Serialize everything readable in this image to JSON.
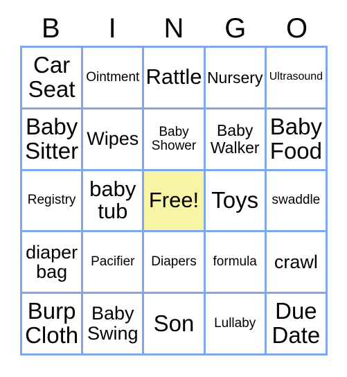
{
  "card": {
    "header_letters": [
      "B",
      "I",
      "N",
      "G",
      "O"
    ],
    "free_cell_color": "#f7f4a3",
    "border_color": "#7da7e8",
    "text_color": "#000000",
    "background_color": "#ffffff",
    "rows": [
      [
        {
          "label": "Car Seat",
          "size": "xl",
          "free": false
        },
        {
          "label": "Ointment",
          "size": "xs",
          "free": false
        },
        {
          "label": "Rattle",
          "size": "lg",
          "free": false
        },
        {
          "label": "Nursery",
          "size": "sm",
          "free": false
        },
        {
          "label": "Ultrasound",
          "size": "xxs",
          "free": false
        }
      ],
      [
        {
          "label": "Baby Sitter",
          "size": "xl",
          "free": false
        },
        {
          "label": "Wipes",
          "size": "md",
          "free": false
        },
        {
          "label": "Baby Shower",
          "size": "xs",
          "free": false
        },
        {
          "label": "Baby Walker",
          "size": "sm",
          "free": false
        },
        {
          "label": "Baby Food",
          "size": "xl",
          "free": false
        }
      ],
      [
        {
          "label": "Registry",
          "size": "xs",
          "free": false
        },
        {
          "label": "baby tub",
          "size": "lg",
          "free": false
        },
        {
          "label": "Free!",
          "size": "lg",
          "free": true
        },
        {
          "label": "Toys",
          "size": "xl",
          "free": false
        },
        {
          "label": "swaddle",
          "size": "xs",
          "free": false
        }
      ],
      [
        {
          "label": "diaper bag",
          "size": "md",
          "free": false
        },
        {
          "label": "Pacifier",
          "size": "xs",
          "free": false
        },
        {
          "label": "Diapers",
          "size": "xs",
          "free": false
        },
        {
          "label": "formula",
          "size": "xs",
          "free": false
        },
        {
          "label": "crawl",
          "size": "md",
          "free": false
        }
      ],
      [
        {
          "label": "Burp Cloth",
          "size": "xl",
          "free": false
        },
        {
          "label": "Baby Swing",
          "size": "md",
          "free": false
        },
        {
          "label": "Son",
          "size": "xl",
          "free": false
        },
        {
          "label": "Lullaby",
          "size": "xs",
          "free": false
        },
        {
          "label": "Due Date",
          "size": "xl",
          "free": false
        }
      ]
    ]
  }
}
